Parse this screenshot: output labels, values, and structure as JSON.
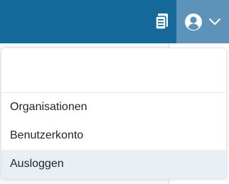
{
  "topbar": {
    "clipboard_icon": "clipboard-icon",
    "user_icon": "user-circle-icon",
    "chevron_icon": "chevron-down-icon",
    "bar_color": "#156a9b",
    "toggle_color": "#5d93b9"
  },
  "dropdown": {
    "header_text": "",
    "items": [
      {
        "label": "Organisationen"
      },
      {
        "label": "Benutzerkonto"
      },
      {
        "label": "Ausloggen",
        "highlighted": true
      }
    ],
    "highlight_color": "#e8f0f6"
  }
}
